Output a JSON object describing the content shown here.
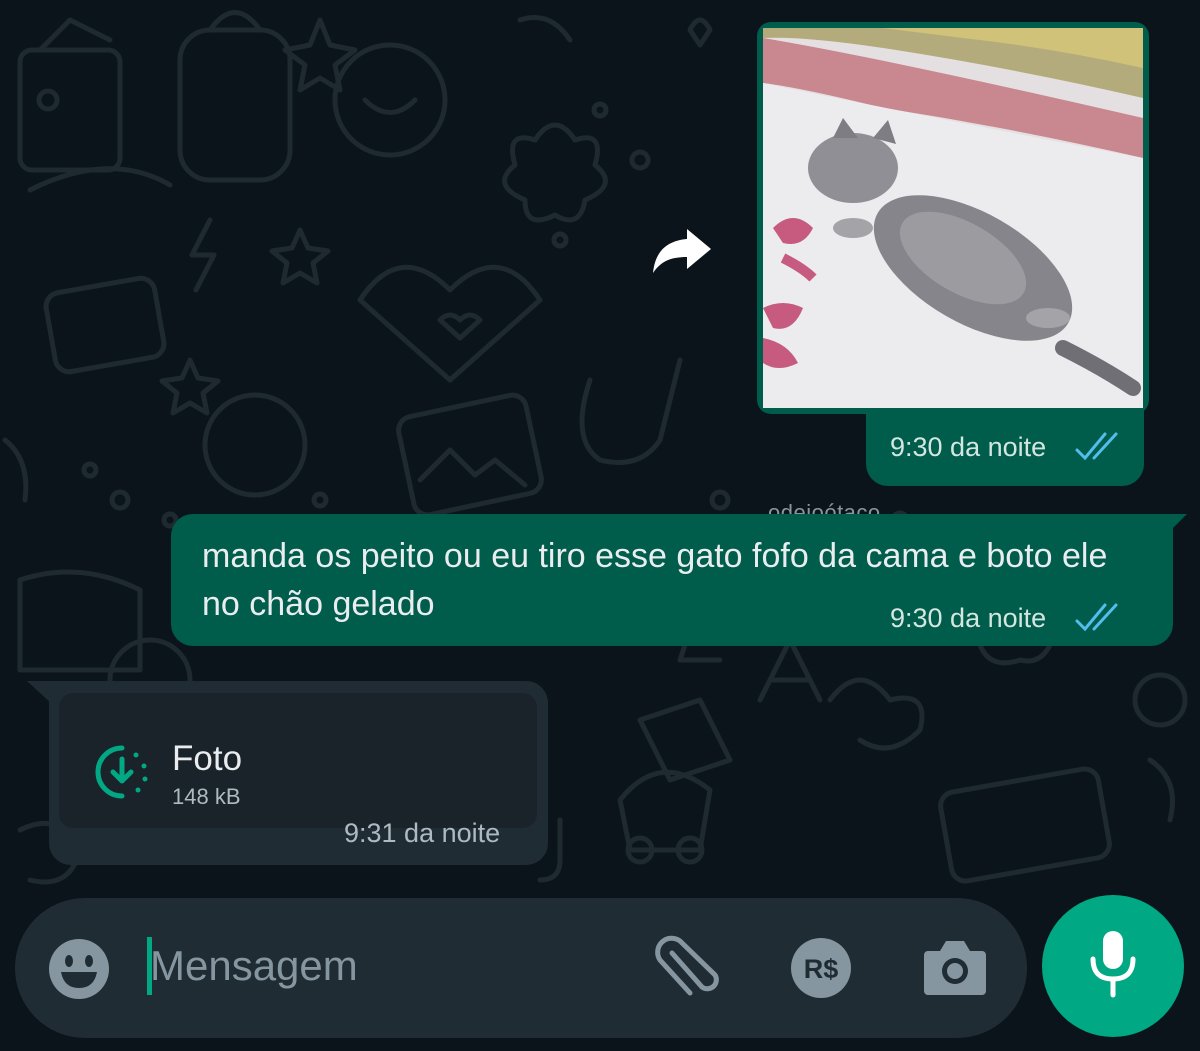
{
  "chat": {
    "forwarded_image": {
      "time": "9:30 da noite",
      "status_icon": "double-check-read-icon"
    },
    "sent_text": {
      "text": "manda os peito ou eu tiro esse gato fofo da cama e boto ele no chão gelado",
      "time": "9:30 da noite",
      "status_icon": "double-check-read-icon"
    },
    "received_photo": {
      "label": "Foto",
      "size": "148 kB",
      "time": "9:31 da noite",
      "icon": "download-icon"
    },
    "watermark": "odeioótaco"
  },
  "composer": {
    "placeholder": "Mensagem",
    "icons": [
      "emoji-icon",
      "attach-icon",
      "payment-icon",
      "camera-icon",
      "mic-icon"
    ],
    "payment_label": "R$"
  },
  "colors": {
    "background": "#0b141a",
    "outgoing_bubble": "#005c4b",
    "incoming_bubble": "#202c33",
    "accent": "#00a884",
    "read_ticks": "#53bdeb"
  }
}
